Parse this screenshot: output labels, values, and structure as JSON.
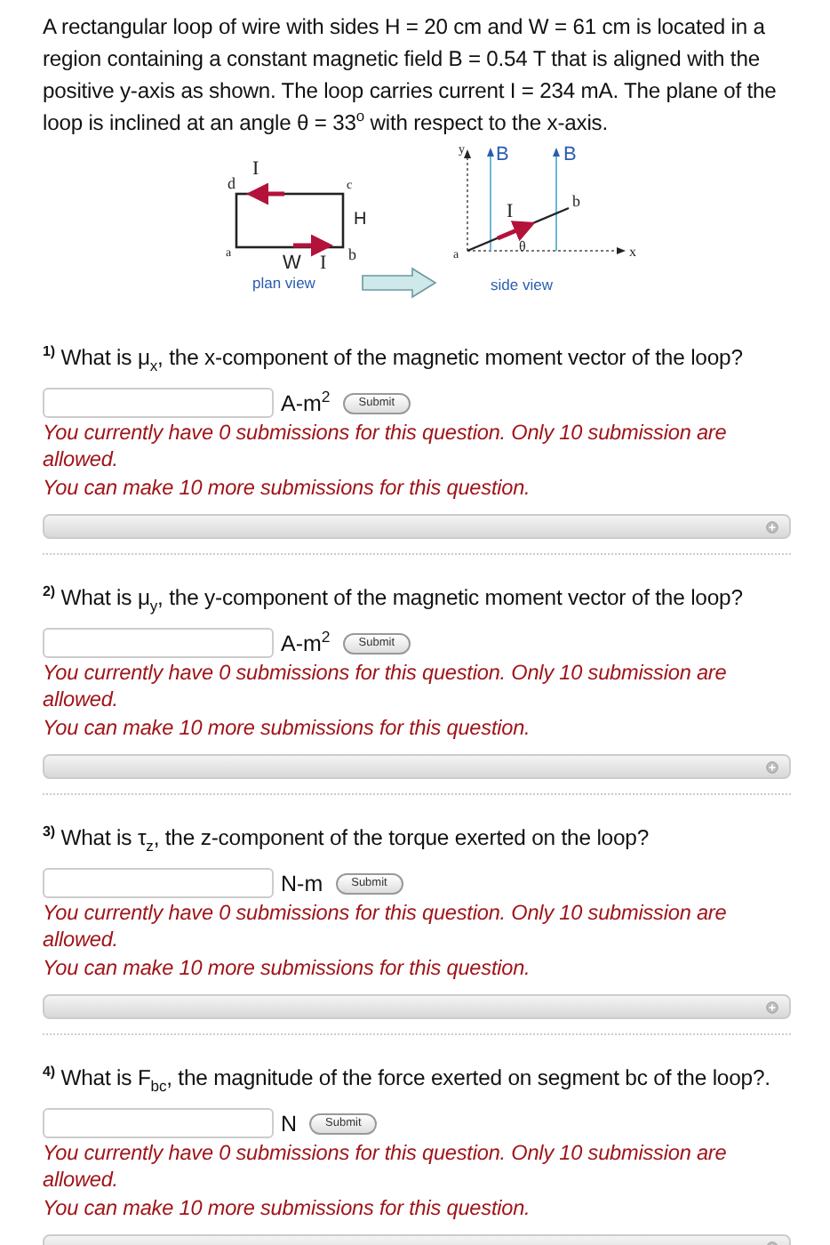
{
  "intro": "A rectangular loop of wire with sides H = 20 cm and W = 61 cm is located in a region containing a constant magnetic field B = 0.54 T that is aligned with the positive y-axis as shown. The loop carries current I = 234 mA. The plane of the loop is inclined at an angle θ = 33$^{o}$ with respect to the x-axis.",
  "diagram": {
    "plan_view_labels": [
      "I",
      "d",
      "c",
      "H",
      "a",
      "W",
      "I",
      "b",
      "plan view"
    ],
    "side_view_labels": [
      "y",
      "B",
      "B",
      "b",
      "I",
      "θ",
      "a",
      "x",
      "side view"
    ]
  },
  "questions": [
    {
      "number": "1)",
      "text": "What is μ$_{x}$, the x-component of the magnetic moment vector of the loop?",
      "unit": "A-m$^{2}$",
      "button": "Submit",
      "warning": "You currently have 0 submissions for this question. Only 10 submission are allowed.",
      "remaining": "You can make 10 more submissions for this question."
    },
    {
      "number": "2)",
      "text": "What is μ$_{y}$, the y-component of the magnetic moment vector of the loop?",
      "unit": "A-m$^{2}$",
      "button": "Submit",
      "warning": "You currently have 0 submissions for this question. Only 10 submission are allowed.",
      "remaining": "You can make 10 more submissions for this question."
    },
    {
      "number": "3)",
      "text": "What is τ$_{z}$, the z-component of the torque exerted on the loop?",
      "unit": "N-m",
      "button": "Submit",
      "warning": "You currently have 0 submissions for this question. Only 10 submission are allowed.",
      "remaining": "You can make 10 more submissions for this question."
    },
    {
      "number": "4)",
      "text": "What is F$_{bc}$, the magnitude of the force exerted on segment bc of the loop?.",
      "unit": "N",
      "button": "Submit",
      "warning": "You currently have 0 submissions for this question. Only 10 submission are allowed.",
      "remaining": "You can make 10 more submissions for this question."
    }
  ]
}
